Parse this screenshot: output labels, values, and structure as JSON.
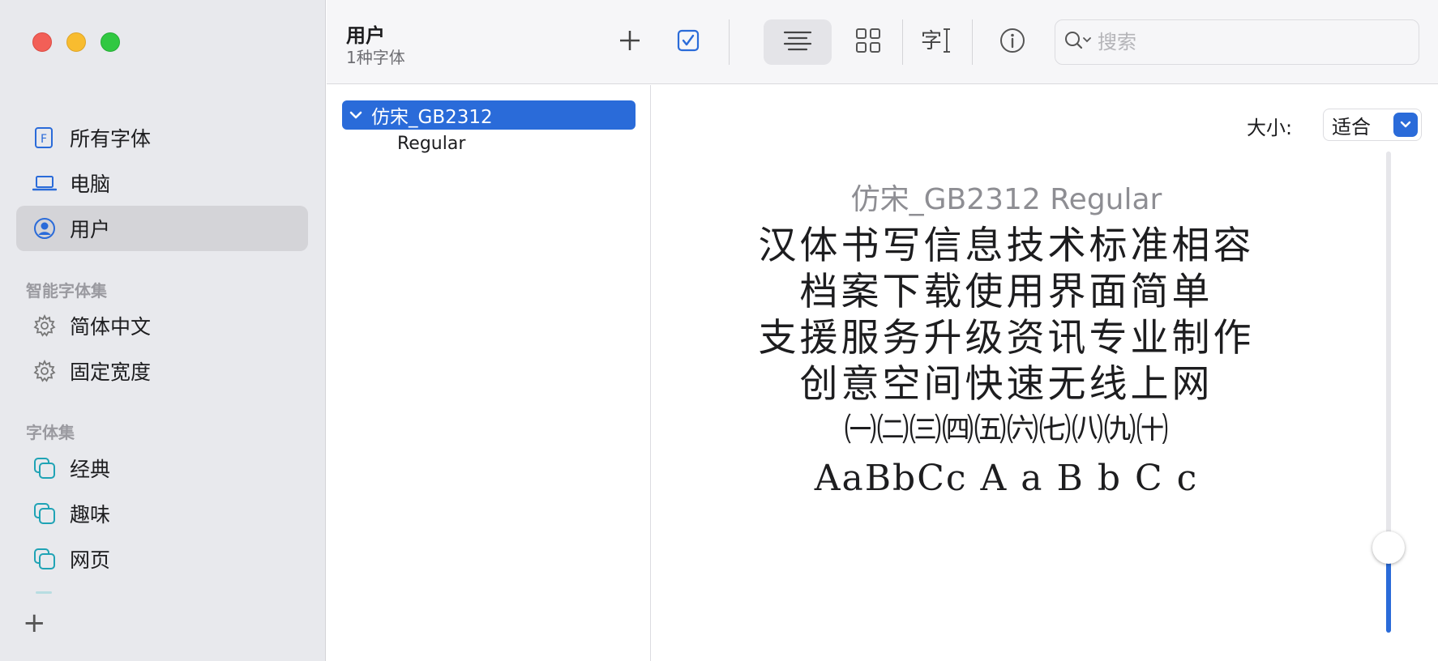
{
  "sidebar": {
    "items": [
      {
        "label": "所有字体",
        "icon": "font-file-icon"
      },
      {
        "label": "电脑",
        "icon": "laptop-icon"
      },
      {
        "label": "用户",
        "icon": "user-icon"
      }
    ],
    "smart_section_title": "智能字体集",
    "smart_items": [
      {
        "label": "简体中文",
        "icon": "gear-icon"
      },
      {
        "label": "固定宽度",
        "icon": "gear-icon"
      }
    ],
    "collection_section_title": "字体集",
    "collection_items": [
      {
        "label": "经典",
        "icon": "collection-icon"
      },
      {
        "label": "趣味",
        "icon": "collection-icon"
      },
      {
        "label": "网页",
        "icon": "collection-icon"
      }
    ],
    "add_label": "+"
  },
  "toolbar": {
    "title": "用户",
    "subtitle": "1种字体",
    "add_label": "+",
    "search_placeholder": "搜索",
    "search_value": ""
  },
  "font_list": {
    "family": "仿宋_GB2312",
    "styles": [
      "Regular"
    ]
  },
  "preview": {
    "size_label": "大小:",
    "size_value": "适合",
    "sample_title": "仿宋_GB2312 Regular",
    "sample_lines": [
      "汉体书写信息技术标准相容",
      "档案下载使用界面简单",
      "支援服务升级资讯专业制作",
      "创意空间快速无线上网",
      "㈠㈡㈢㈣㈤㈥㈦㈧㈨㈩",
      "AaBbCc  A a B b C c"
    ],
    "slider_level": 0.15
  },
  "colors": {
    "accent": "#2a6bd9",
    "sidebar_bg": "#e8e9ed",
    "close": "#f25f57",
    "minimize": "#f8bc2f",
    "zoom": "#30c841"
  }
}
